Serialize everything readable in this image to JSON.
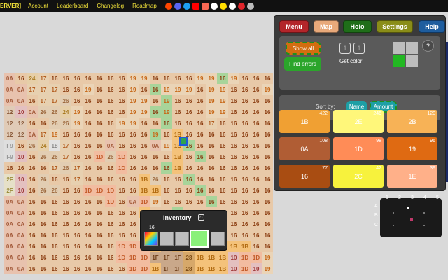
{
  "topbar": {
    "brand": "ERVER]",
    "links": [
      "Account",
      "Leaderboard",
      "Changelog",
      "Roadmap"
    ],
    "icons": [
      "reddit-icon",
      "discord-icon",
      "twitter-icon",
      "youtube-icon",
      "patreon-icon",
      "kofi-icon",
      "donate-icon",
      "settings-icon",
      "close-icon",
      "refresh-icon"
    ]
  },
  "panel": {
    "tabs": {
      "menu": "Menu",
      "map": "Map",
      "holo": "Holo",
      "settings": "Settings",
      "help": "Help"
    },
    "show_all": "Show all",
    "find_errors": "Find errors",
    "get_color_label": "Get color",
    "get_color_box_1": "1",
    "get_color_box_2": "1",
    "help_mark": "?",
    "sort_by": "Sort by:",
    "sort_name": "Name",
    "sort_amount": "Amount"
  },
  "color_cards": [
    {
      "label": "1B",
      "count": "422",
      "color": "#f0a033"
    },
    {
      "label": "2E",
      "count": "246",
      "color": "#fff77a"
    },
    {
      "label": "2B",
      "count": "120",
      "color": "#f7b256"
    },
    {
      "label": "0A",
      "count": "108",
      "color": "#b05d34"
    },
    {
      "label": "1D",
      "count": "98",
      "color": "#ff8c57"
    },
    {
      "label": "19",
      "count": "96",
      "color": "#df6a12"
    },
    {
      "label": "16",
      "count": "77",
      "color": "#a94d12"
    },
    {
      "label": "2C",
      "count": "42",
      "color": "#f7f23d"
    },
    {
      "label": "1E",
      "count": "39",
      "color": "#ffb089"
    }
  ],
  "inventory": {
    "title": "Inventory",
    "count": "16",
    "icon": "user-icon"
  },
  "minimap": {
    "col_numbers": [
      "1",
      "2",
      "3",
      "4",
      "5"
    ],
    "row_letters": [
      "A",
      "B",
      "C"
    ]
  },
  "grid": {
    "rows": [
      [
        "0A",
        "16",
        "24",
        "17",
        "16",
        "16",
        "16",
        "16",
        "16",
        "16",
        "16",
        "19",
        "19",
        "16",
        "16",
        "16",
        "16",
        "19",
        "19",
        "16",
        "19",
        "16",
        "16",
        "16"
      ],
      [
        "0A",
        "0A",
        "17",
        "17",
        "17",
        "16",
        "16",
        "19",
        "16",
        "16",
        "16",
        "19",
        "16",
        "16",
        "19",
        "19",
        "19",
        "16",
        "19",
        "19",
        "16",
        "16",
        "16",
        "19"
      ],
      [
        "0A",
        "0A",
        "16",
        "17",
        "17",
        "26",
        "16",
        "16",
        "16",
        "16",
        "16",
        "19",
        "19",
        "16",
        "19",
        "16",
        "16",
        "16",
        "19",
        "19",
        "16",
        "16",
        "16",
        "16"
      ],
      [
        "12",
        "10",
        "0A",
        "26",
        "26",
        "24",
        "19",
        "16",
        "16",
        "16",
        "16",
        "19",
        "19",
        "16",
        "19",
        "16",
        "16",
        "16",
        "19",
        "19",
        "16",
        "16",
        "16",
        "16"
      ],
      [
        "12",
        "12",
        "16",
        "16",
        "26",
        "26",
        "19",
        "16",
        "16",
        "16",
        "19",
        "19",
        "16",
        "16",
        "16",
        "16",
        "16",
        "16",
        "17",
        "16",
        "16",
        "16",
        "16",
        "16"
      ],
      [
        "12",
        "12",
        "0A",
        "17",
        "19",
        "16",
        "16",
        "16",
        "16",
        "16",
        "16",
        "16",
        "16",
        "19",
        "16",
        "1B",
        "16",
        "16",
        "16",
        "16",
        "16",
        "16",
        "16",
        "16"
      ],
      [
        "F9",
        "16",
        "26",
        "24",
        "18",
        "17",
        "16",
        "16",
        "16",
        "0A",
        "16",
        "16",
        "16",
        "0A",
        "19",
        "1B",
        "16",
        "16",
        "16",
        "16",
        "16",
        "16",
        "16",
        "16"
      ],
      [
        "F9",
        "10",
        "16",
        "26",
        "26",
        "17",
        "16",
        "16",
        "1D",
        "26",
        "1D",
        "16",
        "16",
        "16",
        "16",
        "1B",
        "16",
        "16",
        "16",
        "16",
        "16",
        "16",
        "16",
        "16"
      ],
      [
        "16",
        "16",
        "16",
        "16",
        "17",
        "26",
        "17",
        "16",
        "16",
        "16",
        "1D",
        "16",
        "16",
        "16",
        "16",
        "1B",
        "16",
        "16",
        "16",
        "16",
        "16",
        "16",
        "16",
        "16"
      ],
      [
        "2F",
        "10",
        "16",
        "26",
        "16",
        "16",
        "17",
        "16",
        "16",
        "16",
        "16",
        "16",
        "1B",
        "26",
        "16",
        "16",
        "16",
        "16",
        "16",
        "16",
        "16",
        "16",
        "16",
        "16"
      ],
      [
        "2F",
        "10",
        "16",
        "26",
        "26",
        "16",
        "16",
        "1D",
        "1D",
        "1D",
        "16",
        "16",
        "1B",
        "1B",
        "16",
        "16",
        "16",
        "16",
        "16",
        "16",
        "16",
        "16",
        "16",
        "16"
      ],
      [
        "0A",
        "0A",
        "16",
        "16",
        "16",
        "16",
        "16",
        "16",
        "16",
        "1D",
        "16",
        "0A",
        "1D",
        "19",
        "16",
        "16",
        "16",
        "16",
        "16",
        "16",
        "16",
        "16",
        "16",
        "16"
      ],
      [
        "0A",
        "0A",
        "16",
        "16",
        "16",
        "16",
        "16",
        "16",
        "16",
        "16",
        "16",
        "16",
        "1B",
        "16",
        "16",
        "16",
        "16",
        "16",
        "16",
        "16",
        "16",
        "16",
        "16",
        "16"
      ],
      [
        "0A",
        "0A",
        "16",
        "16",
        "16",
        "16",
        "16",
        "16",
        "16",
        "16",
        "16",
        "16",
        "19",
        "2B",
        "2B",
        "1B",
        "16",
        "16",
        "16",
        "16",
        "16",
        "16",
        "16",
        "16"
      ],
      [
        "0A",
        "0A",
        "16",
        "16",
        "16",
        "16",
        "16",
        "16",
        "16",
        "16",
        "16",
        "16",
        "19",
        "2B",
        "2B",
        "1B",
        "1B",
        "16",
        "16",
        "16",
        "16",
        "16",
        "16",
        "16"
      ],
      [
        "0A",
        "0A",
        "16",
        "16",
        "16",
        "16",
        "16",
        "16",
        "16",
        "16",
        "1D",
        "1D",
        "1D",
        "1B",
        "1F",
        "28",
        "1B",
        "1B",
        "1B",
        "1B",
        "1B",
        "1B",
        "16",
        "16"
      ],
      [
        "0A",
        "0A",
        "16",
        "16",
        "16",
        "16",
        "16",
        "16",
        "16",
        "16",
        "1D",
        "1D",
        "1D",
        "1F",
        "1F",
        "1F",
        "28",
        "1B",
        "1B",
        "1B",
        "10",
        "1D",
        "1D",
        "19"
      ],
      [
        "0A",
        "0A",
        "16",
        "16",
        "16",
        "16",
        "16",
        "16",
        "16",
        "16",
        "16",
        "1D",
        "1D",
        "1B",
        "1F",
        "1F",
        "28",
        "1B",
        "1B",
        "1B",
        "10",
        "1D",
        "10",
        "19"
      ]
    ]
  }
}
